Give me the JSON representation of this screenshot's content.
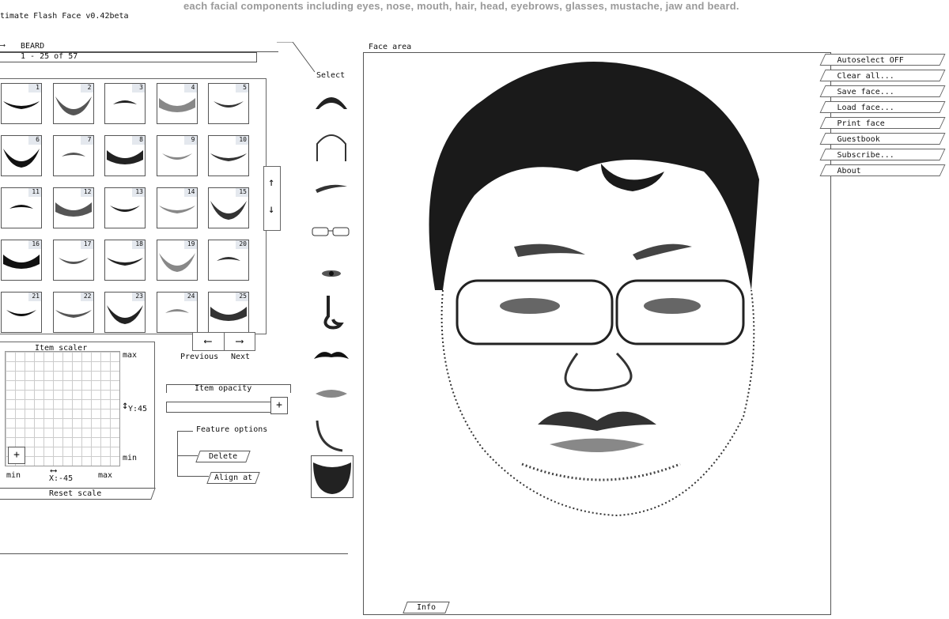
{
  "header": {
    "tagline": "each facial components including eyes, nose, mouth, hair, head, eyebrows, glasses, mustache, jaw and beard.",
    "app_title": "timate Flash Face v0.42beta"
  },
  "category": {
    "name": "BEARD",
    "range": "1 - 25 of 57"
  },
  "thumbnails": [
    "1",
    "2",
    "3",
    "4",
    "5",
    "6",
    "7",
    "8",
    "9",
    "10",
    "11",
    "12",
    "13",
    "14",
    "15",
    "16",
    "17",
    "18",
    "19",
    "20",
    "21",
    "22",
    "23",
    "24",
    "25"
  ],
  "pager": {
    "prev_label": "Previous",
    "next_label": "Next",
    "prev_icon": "left-arrow-icon",
    "next_icon": "right-arrow-icon"
  },
  "select": {
    "label": "Select",
    "items": [
      "hair",
      "head",
      "eyebrows",
      "glasses",
      "eyes",
      "nose",
      "mustache",
      "mouth",
      "jaw",
      "beard"
    ]
  },
  "scaler": {
    "title": "Item scaler",
    "y_max": "max",
    "y_min": "min",
    "y_value": "Y:45",
    "x_min": "min",
    "x_max": "max",
    "x_value": "X:-45",
    "reset": "Reset scale"
  },
  "opacity": {
    "title": "Item opacity"
  },
  "feature_options": {
    "title": "Feature options",
    "delete": "Delete",
    "align": "Align at"
  },
  "face_area": {
    "title": "Face area",
    "info": "Info"
  },
  "menu": [
    "Autoselect OFF",
    "Clear all...",
    "Save face...",
    "Load face...",
    "Print face",
    "Guestbook",
    "Subscribe...",
    "About"
  ]
}
